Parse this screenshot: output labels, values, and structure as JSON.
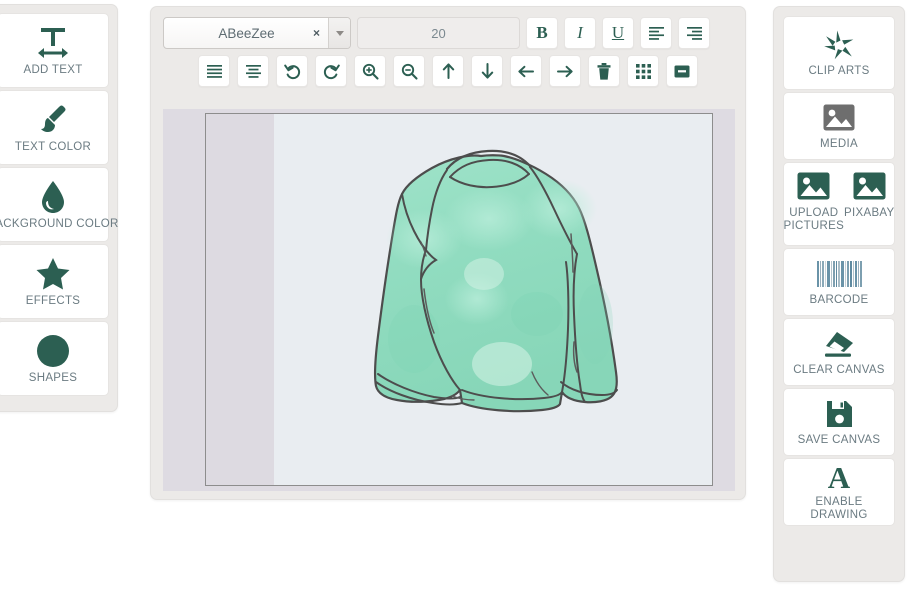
{
  "theme": {
    "accent": "#2c5f52",
    "caption_color": "#6b7b82",
    "panel_bg": "#eceae8",
    "card_bg": "#ffffff",
    "canvas_mat": "#dedbe2",
    "canvas_page": "#e9edf1",
    "shirt_fill": "#8fdcc0",
    "shirt_stroke": "#4a4a4a"
  },
  "left_panel": {
    "items": [
      {
        "label": "ADD TEXT",
        "icon": "text-resize-icon"
      },
      {
        "label": "TEXT COLOR",
        "icon": "paintbrush-icon"
      },
      {
        "label": "BACKGROUND COLOR",
        "icon": "water-drop-icon"
      },
      {
        "label": "EFFECTS",
        "icon": "star-icon"
      },
      {
        "label": "SHAPES",
        "icon": "circle-icon"
      }
    ]
  },
  "toolbar": {
    "font_select": {
      "value": "ABeeZee",
      "clear_glyph": "×",
      "dropdown_icon": "chevron-down-icon"
    },
    "font_size": {
      "value": "20",
      "placeholder": "20"
    },
    "row1_buttons": [
      {
        "label": "B",
        "name": "bold-button",
        "icon": "bold-icon"
      },
      {
        "label": "I",
        "name": "italic-button",
        "icon": "italic-icon"
      },
      {
        "label": "U",
        "name": "underline-button",
        "icon": "underline-icon"
      },
      {
        "label": "",
        "name": "align-left-button",
        "icon": "align-left-icon"
      },
      {
        "label": "",
        "name": "align-right-button",
        "icon": "align-right-icon"
      }
    ],
    "row2_buttons": [
      {
        "name": "align-justify-button",
        "icon": "align-justify-icon"
      },
      {
        "name": "align-center-button",
        "icon": "align-center-icon"
      },
      {
        "name": "undo-button",
        "icon": "undo-icon"
      },
      {
        "name": "redo-button",
        "icon": "redo-icon"
      },
      {
        "name": "zoom-in-button",
        "icon": "zoom-in-icon"
      },
      {
        "name": "zoom-out-button",
        "icon": "zoom-out-icon"
      },
      {
        "name": "move-up-button",
        "icon": "arrow-up-icon"
      },
      {
        "name": "move-down-button",
        "icon": "arrow-down-icon"
      },
      {
        "name": "move-left-button",
        "icon": "arrow-left-icon"
      },
      {
        "name": "move-right-button",
        "icon": "arrow-right-icon"
      },
      {
        "name": "delete-button",
        "icon": "trash-icon"
      },
      {
        "name": "grid-button",
        "icon": "grid-icon"
      },
      {
        "name": "minimize-button",
        "icon": "minus-box-icon"
      }
    ]
  },
  "canvas": {
    "artwork_name": "long-sleeve-sweatshirt-illustration"
  },
  "right_panel": {
    "items": [
      {
        "label": "CLIP ARTS",
        "icon": "pinwheel-icon",
        "type": "single"
      },
      {
        "label": "MEDIA",
        "icon": "image-icon-gray",
        "type": "single"
      },
      {
        "type": "dual",
        "left_label": "UPLOAD PICTURES",
        "left_icon": "image-upload-icon",
        "right_label": "PIXABAY",
        "right_icon": "image-pixabay-icon"
      },
      {
        "label": "BARCODE",
        "icon": "barcode-icon",
        "type": "single"
      },
      {
        "label": "CLEAR CANVAS",
        "icon": "eraser-icon",
        "type": "single"
      },
      {
        "label": "SAVE CANVAS",
        "icon": "floppy-disk-icon",
        "type": "single"
      },
      {
        "label": "ENABLE DRAWING",
        "icon": "letter-a-icon",
        "type": "single"
      }
    ]
  }
}
